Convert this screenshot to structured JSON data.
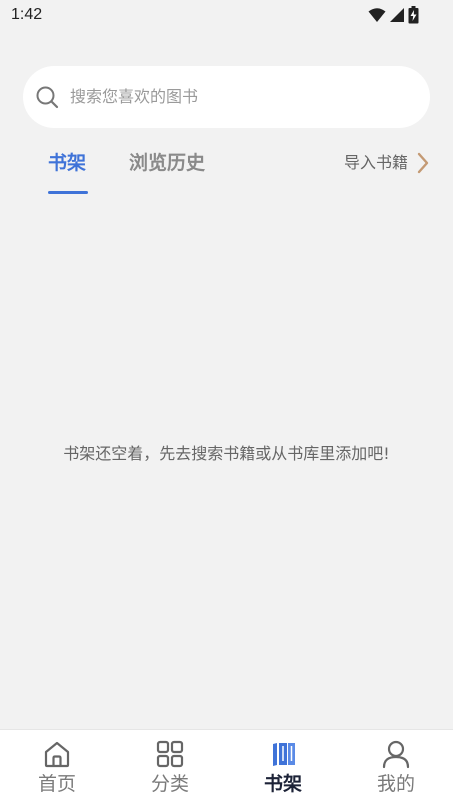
{
  "status_bar": {
    "time": "1:42",
    "icons": [
      "wifi-icon",
      "cellular-signal-icon",
      "battery-charging-icon"
    ]
  },
  "search": {
    "placeholder": "搜索您喜欢的图书",
    "icon": "search-icon"
  },
  "tabs": [
    {
      "label": "书架",
      "active": true
    },
    {
      "label": "浏览历史",
      "active": false
    }
  ],
  "import": {
    "label": "导入书籍",
    "icon": "chevron-right-icon"
  },
  "empty_state": {
    "message": "书架还空着，先去搜索书籍或从书库里添加吧!"
  },
  "bottom_nav": [
    {
      "label": "首页",
      "icon": "home-icon",
      "active": false
    },
    {
      "label": "分类",
      "icon": "grid-icon",
      "active": false
    },
    {
      "label": "书架",
      "icon": "bookshelf-icon",
      "active": true
    },
    {
      "label": "我的",
      "icon": "person-icon",
      "active": false
    }
  ],
  "colors": {
    "accent": "#3f73d8",
    "background": "#f2f2f2",
    "chevron": "#c49a74",
    "nav_active_text": "#1c2237"
  }
}
